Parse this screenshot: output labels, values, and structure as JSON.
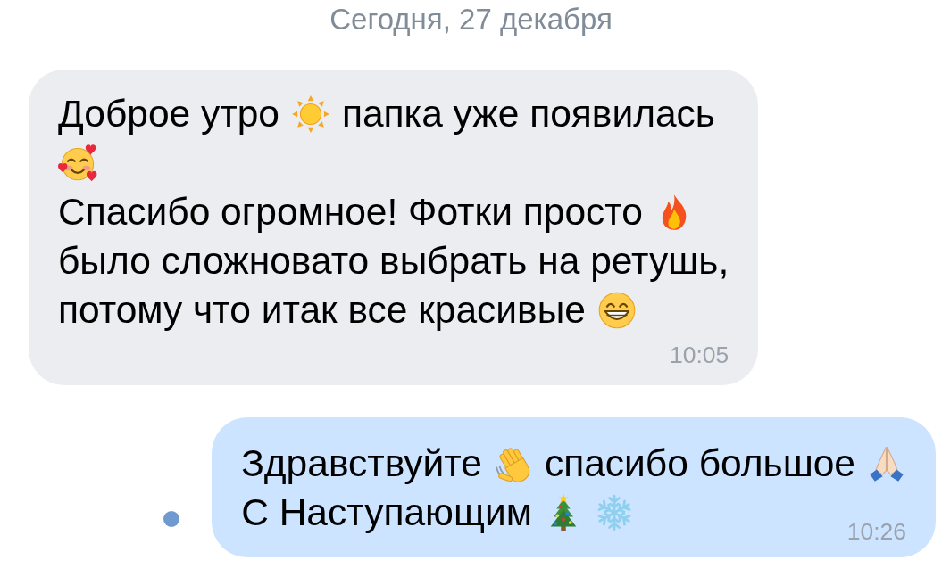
{
  "date_header": "Сегодня, 27 декабря",
  "messages": [
    {
      "kind": "incoming",
      "unread": false,
      "time": "10:05",
      "lines": [
        [
          {
            "kind": "text",
            "text": "Доброе утро"
          },
          {
            "kind": "sun"
          },
          {
            "kind": "text",
            "text": "папка уже появилась"
          }
        ],
        [
          {
            "kind": "hearts"
          }
        ],
        [
          {
            "kind": "text",
            "text": "Спасибо огромное! Фотки просто"
          },
          {
            "kind": "fire"
          }
        ],
        [
          {
            "kind": "text",
            "text": "было сложновато выбрать на ретушь,"
          }
        ],
        [
          {
            "kind": "text",
            "text": "потому что итак все красивые"
          },
          {
            "kind": "grin"
          }
        ]
      ]
    },
    {
      "kind": "outgoing",
      "unread": true,
      "time": "10:26",
      "lines": [
        [
          {
            "kind": "text",
            "text": "Здравствуйте"
          },
          {
            "kind": "wave"
          },
          {
            "kind": "text",
            "text": "спасибо большое"
          },
          {
            "kind": "pray"
          }
        ],
        [
          {
            "kind": "text",
            "text": "С Наступающим"
          },
          {
            "kind": "tree"
          },
          {
            "kind": "snowflake"
          }
        ]
      ]
    }
  ]
}
